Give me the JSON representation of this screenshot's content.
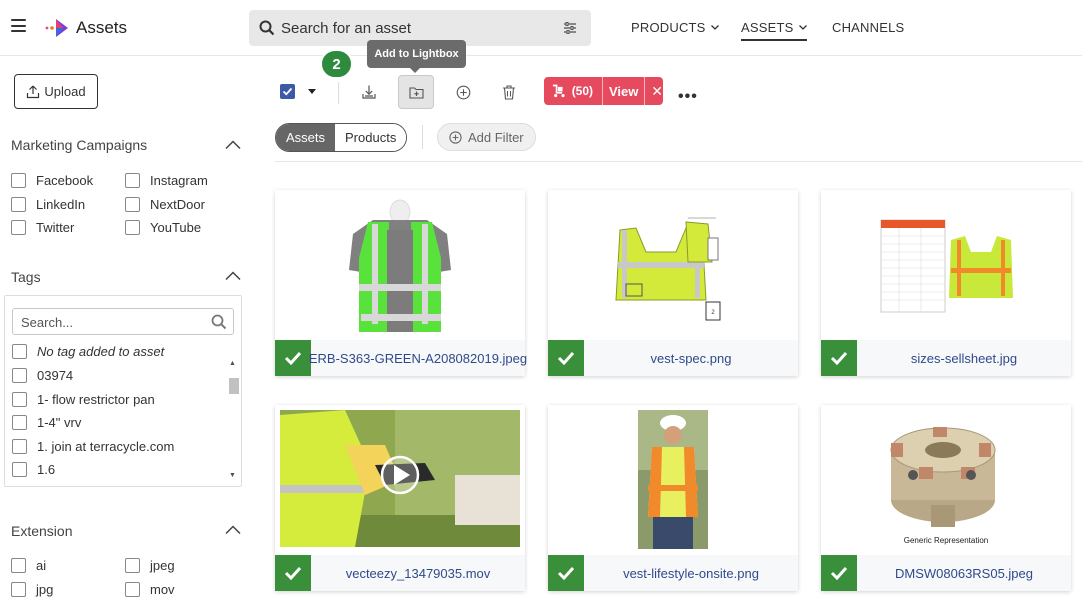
{
  "app": {
    "title": "Assets"
  },
  "search": {
    "placeholder": "Search for an asset"
  },
  "nav": {
    "items": [
      "PRODUCTS",
      "ASSETS",
      "CHANNELS"
    ],
    "active": "ASSETS"
  },
  "sidebar": {
    "upload_label": "Upload",
    "marketing": {
      "title": "Marketing Campaigns",
      "options": [
        "Facebook",
        "Instagram",
        "LinkedIn",
        "NextDoor",
        "Twitter",
        "YouTube"
      ]
    },
    "tags": {
      "title": "Tags",
      "search_placeholder": "Search...",
      "options": [
        "No tag added to asset",
        "03974",
        "1- flow restrictor pan",
        "1-4\" vrv",
        "1. join at terracycle.com",
        "1.6"
      ]
    },
    "extension": {
      "title": "Extension",
      "options": [
        "ai",
        "jpeg",
        "jpg",
        "mov"
      ]
    }
  },
  "toolbar": {
    "selected_count": "2",
    "tooltip": "Add to Lightbox",
    "lightbox_count": "(50)",
    "lightbox_view": "View",
    "lightbox_close": "✕",
    "more": "•••"
  },
  "filters": {
    "segments": [
      "Assets",
      "Products"
    ],
    "active_segment": "Assets",
    "add_filter_label": "Add Filter"
  },
  "assets": [
    {
      "filename": "ERB-S363-GREEN-A208082019.jpeg",
      "selected": true
    },
    {
      "filename": "vest-spec.png",
      "selected": true
    },
    {
      "filename": "sizes-sellsheet.jpg",
      "selected": true
    },
    {
      "filename": "vecteezy_13479035.mov",
      "selected": true
    },
    {
      "filename": "vest-lifestyle-onsite.png",
      "selected": true
    },
    {
      "filename": "DMSW08063RS05.jpeg",
      "selected": true
    }
  ],
  "asset_captions": {
    "cutter_caption": "Generic Representation"
  },
  "colors": {
    "check_green": "#3a8f3a",
    "lightbox_red": "#e64a5f",
    "accent_blue": "#3c5aa6",
    "badge_green": "#2e8b3e"
  }
}
